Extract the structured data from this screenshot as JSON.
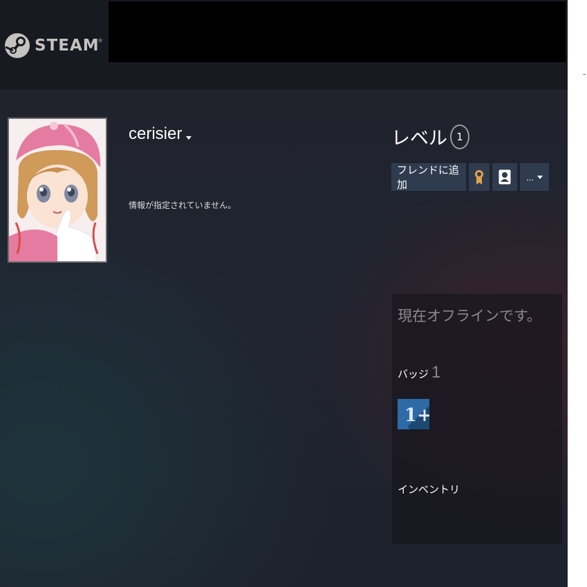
{
  "header": {
    "logo_text": "STEAM",
    "logo_mark": "®",
    "logo_icon": "steam-logo-icon",
    "side_mark": "-"
  },
  "profile": {
    "avatar_icon": "avatar",
    "username": "cerisier",
    "summary": "情報が指定されていません。",
    "level_label": "レベル",
    "level_value": "1",
    "actions": {
      "add_friend_label": "フレンドに追加",
      "award_icon": "award-icon",
      "profile_icon": "profile-card-icon",
      "more_label": "..."
    },
    "status_text": "現在オフラインです。",
    "badges_label": "バッジ",
    "badges_count": "1",
    "badge_tile_label": "1+",
    "inventory_label": "インベントリ"
  },
  "colors": {
    "header_bg": "#171a21",
    "button_bg": "#2f3c4f",
    "badge_blue": "#2e6aa6",
    "award_gold": "#e2a24a"
  }
}
